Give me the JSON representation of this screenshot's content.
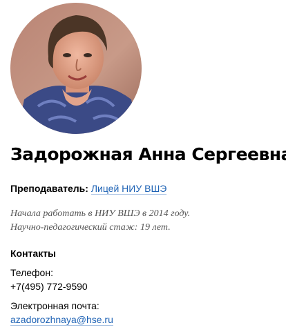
{
  "profile": {
    "name": "Задорожная Анна Сергеевна",
    "role_label": "Преподаватель:",
    "role_link": "Лицей НИУ ВШЭ",
    "bio_line1": "Начала работать в НИУ ВШЭ в 2014 году.",
    "bio_line2": "Научно-педагогический стаж: 19 лет."
  },
  "contacts": {
    "title": "Контакты",
    "phone_label": "Телефон:",
    "phone_value": "+7(495) 772-9590",
    "email_label": "Электронная почта:",
    "email_value": "azadorozhnaya@hse.ru"
  },
  "colors": {
    "link": "#1f63b5",
    "bio_text": "#555555"
  }
}
